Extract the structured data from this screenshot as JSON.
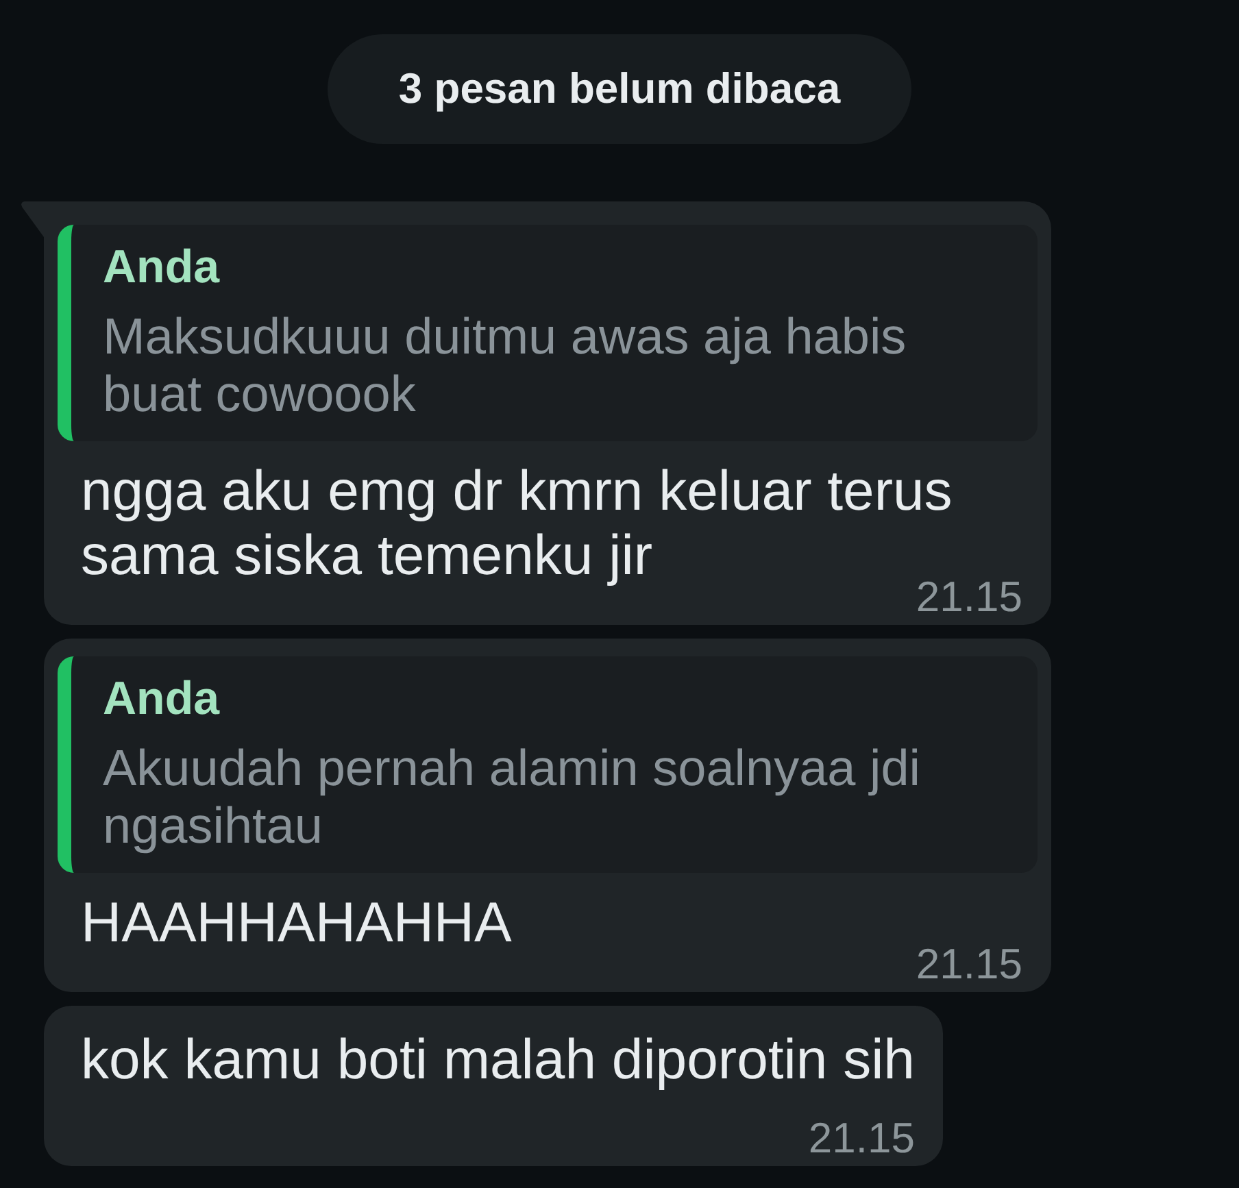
{
  "banner": {
    "text": "3 pesan belum dibaca"
  },
  "messages": [
    {
      "tail": true,
      "quote": {
        "author": "Anda",
        "text": "Maksudkuuu duitmu awas aja habis buat cowoook"
      },
      "text": "ngga aku emg dr kmrn keluar terus sama siska temenku jir",
      "time": "21.15"
    },
    {
      "tail": false,
      "quote": {
        "author": "Anda",
        "text": "Akuudah pernah alamin soalnyaa jdi ngasihtau"
      },
      "text": "HAAHHAHAHHA",
      "time": "21.15"
    },
    {
      "tail": false,
      "text": "kok kamu boti malah diporotin sih",
      "time": "21.15"
    }
  ]
}
